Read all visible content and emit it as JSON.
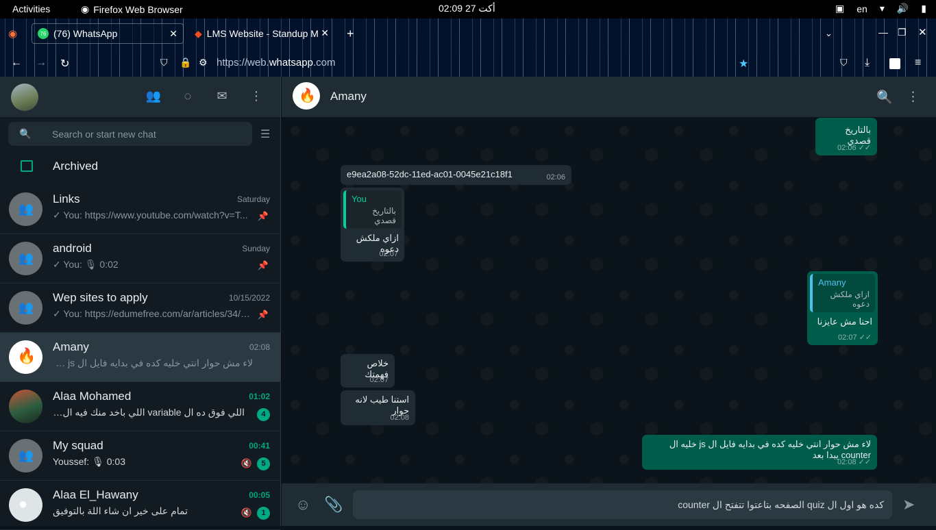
{
  "system_bar": {
    "activities": "Activities",
    "app_name": "Firefox Web Browser",
    "clock": "أكت 27  02:09",
    "lang": "en"
  },
  "browser": {
    "tabs": [
      {
        "label": "(76) WhatsApp",
        "favicon_badge": "76"
      },
      {
        "label": "LMS Website - Standup M"
      }
    ],
    "url_prefix": "https://web.",
    "url_host": "whatsapp",
    "url_suffix": ".com"
  },
  "sidebar": {
    "search_placeholder": "Search or start new chat",
    "archived_label": "Archived",
    "chats": [
      {
        "name": "Links",
        "time": "Saturday",
        "preview": "✓ You: https://www.youtube.com/watch?v=T...",
        "pinned": true
      },
      {
        "name": "android",
        "time": "Sunday",
        "preview": "✓ You: 🎙 0:02",
        "pinned": true
      },
      {
        "name": "Wep sites to apply",
        "time": "10/15/2022",
        "preview": "✓ You: https://edumefree.com/ar/articles/34/2...",
        "pinned": true
      },
      {
        "name": "Amany",
        "time": "02:08",
        "preview": "لاء مش حوار انتي خليه كده في بدايه فايل ال js خليه ال unter...  ✓✓"
      },
      {
        "name": "Alaa Mohamed",
        "time": "01:02",
        "preview": "اللي فوق ده ال variable اللي باخد منك فيه ال id بتاع ال r...",
        "unread": "4"
      },
      {
        "name": "My squad",
        "time": "00:41",
        "preview": "Youssef: 🎙 0:03",
        "unread": "5",
        "muted": true
      },
      {
        "name": "Alaa El_Hawany",
        "time": "00:05",
        "preview": "تمام على خير ان شاء اللة بالتوفيق",
        "unread": "1",
        "muted": true
      }
    ]
  },
  "conversation": {
    "contact_name": "Amany",
    "messages": [
      {
        "dir": "out",
        "text": "بالتاريخ قصدي",
        "time": "02:06"
      },
      {
        "dir": "in",
        "text": "e9ea2a08-52dc-11ed-ac01-0045e21c18f1",
        "time": "02:06"
      },
      {
        "dir": "in",
        "quote_author": "You",
        "quote_text": "بالتاريخ قصدي",
        "text": "ازاي ملكش دعوه",
        "time": "02:07"
      },
      {
        "dir": "out",
        "quote_author": "Amany",
        "quote_text": "ازاي ملكش دعوه",
        "text": "احنا مش عايزنا",
        "time": "02:07"
      },
      {
        "dir": "in",
        "text": "خلاص فهمتك",
        "time": "02:07"
      },
      {
        "dir": "in",
        "text": "استنا طيب لانه حوار",
        "time": "02:08"
      },
      {
        "dir": "out",
        "text": "لاء مش حوار انتي خليه كده في بدايه فايل ال js خليه ال counter يبدا بعد",
        "time": "02:08"
      }
    ],
    "draft": "كده هو اول ال quiz الصفحه بتاعتوا تتفتح ال counter"
  }
}
